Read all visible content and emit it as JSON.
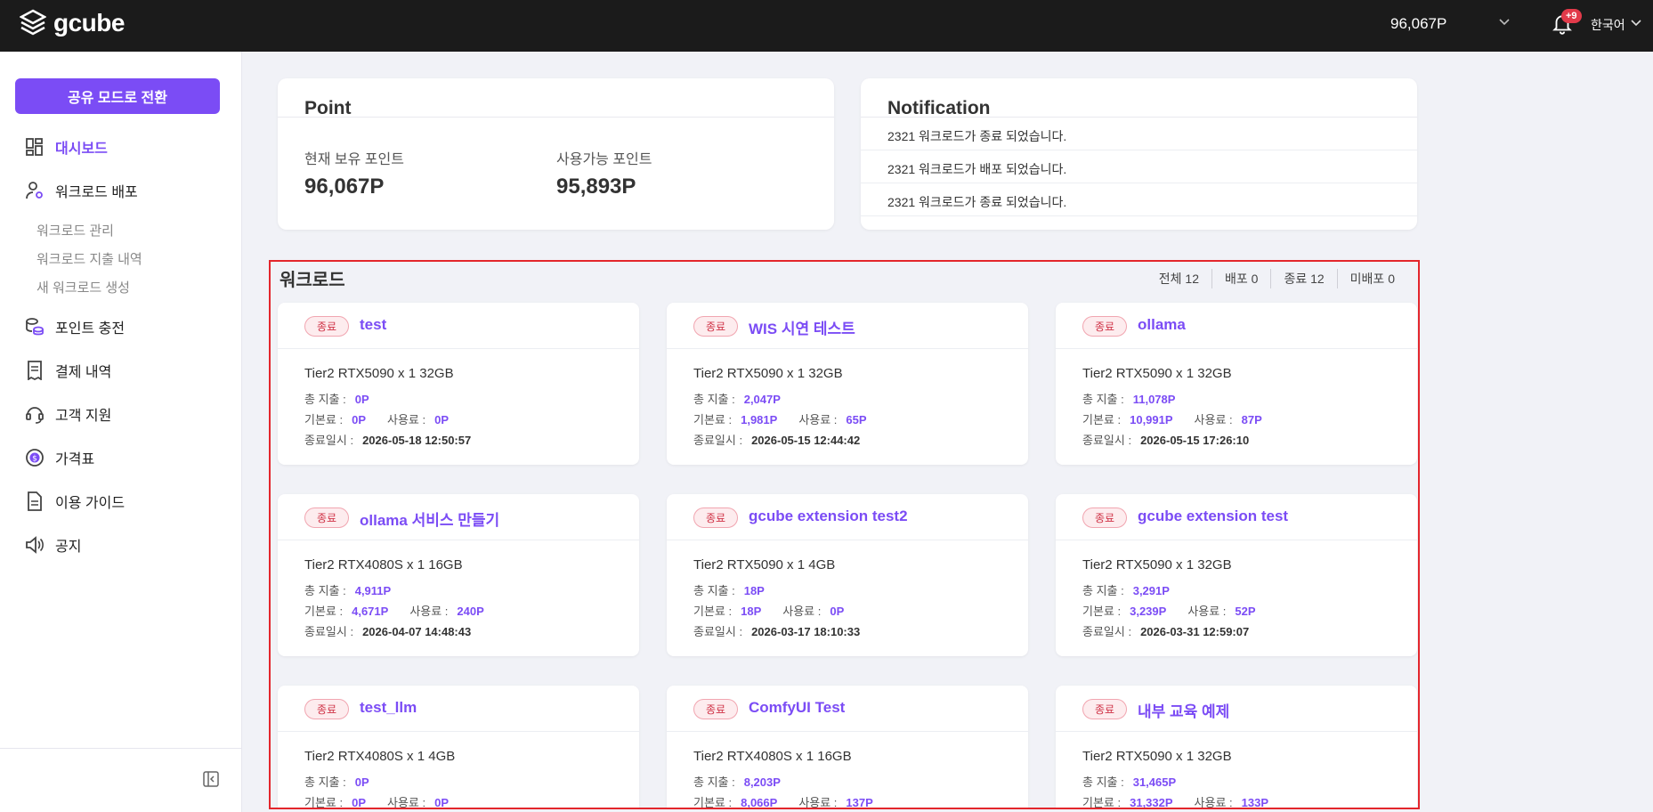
{
  "header": {
    "logo": "gcube",
    "points": "96,067P",
    "notification_badge": "+9",
    "language": "한국어"
  },
  "sidebar": {
    "share_mode_button": "공유 모드로 전환",
    "items": [
      {
        "label": "대시보드",
        "icon": "dashboard-icon",
        "active": true
      },
      {
        "label": "워크로드 배포",
        "icon": "user-gear-icon"
      },
      {
        "label": "포인트 충전",
        "icon": "coins-icon"
      },
      {
        "label": "결제 내역",
        "icon": "receipt-icon"
      },
      {
        "label": "고객 지원",
        "icon": "headset-icon"
      },
      {
        "label": "가격표",
        "icon": "dollar-circle-icon"
      },
      {
        "label": "이용 가이드",
        "icon": "document-icon"
      },
      {
        "label": "공지",
        "icon": "megaphone-icon"
      }
    ],
    "subitems": [
      "워크로드 관리",
      "워크로드 지출 내역",
      "새 워크로드 생성"
    ]
  },
  "point_panel": {
    "title": "Point",
    "held_label": "현재 보유 포인트",
    "held_value": "96,067P",
    "available_label": "사용가능 포인트",
    "available_value": "95,893P"
  },
  "notification_panel": {
    "title": "Notification",
    "items": [
      "2321 워크로드가 종료 되었습니다.",
      "2321 워크로드가 배포 되었습니다.",
      "2321 워크로드가 종료 되었습니다."
    ]
  },
  "workloads": {
    "title": "워크로드",
    "filters": [
      "전체 12",
      "배포 0",
      "종료 12",
      "미배포 0"
    ],
    "labels": {
      "total": "총 지출 :",
      "base": "기본료 :",
      "usage": "사용료 :",
      "ended": "종료일시 :"
    },
    "cards": [
      {
        "status": "종료",
        "name": "test",
        "spec": "Tier2 RTX5090 x 1 32GB",
        "total": "0P",
        "base": "0P",
        "usage": "0P",
        "ended": "2026-05-18 12:50:57"
      },
      {
        "status": "종료",
        "name": "WIS 시연 테스트",
        "spec": "Tier2 RTX5090 x 1 32GB",
        "total": "2,047P",
        "base": "1,981P",
        "usage": "65P",
        "ended": "2026-05-15 12:44:42"
      },
      {
        "status": "종료",
        "name": "ollama",
        "spec": "Tier2 RTX5090 x 1 32GB",
        "total": "11,078P",
        "base": "10,991P",
        "usage": "87P",
        "ended": "2026-05-15 17:26:10"
      },
      {
        "status": "종료",
        "name": "ollama 서비스 만들기",
        "spec": "Tier2 RTX4080S x 1 16GB",
        "total": "4,911P",
        "base": "4,671P",
        "usage": "240P",
        "ended": "2026-04-07 14:48:43"
      },
      {
        "status": "종료",
        "name": "gcube extension test2",
        "spec": "Tier2 RTX5090 x 1 4GB",
        "total": "18P",
        "base": "18P",
        "usage": "0P",
        "ended": "2026-03-17 18:10:33"
      },
      {
        "status": "종료",
        "name": "gcube extension test",
        "spec": "Tier2 RTX5090 x 1 32GB",
        "total": "3,291P",
        "base": "3,239P",
        "usage": "52P",
        "ended": "2026-03-31 12:59:07"
      },
      {
        "status": "종료",
        "name": "test_llm",
        "spec": "Tier2 RTX4080S x 1 4GB",
        "total": "0P",
        "base": "0P",
        "usage": "0P",
        "ended": ""
      },
      {
        "status": "종료",
        "name": "ComfyUI Test",
        "spec": "Tier2 RTX4080S x 1 16GB",
        "total": "8,203P",
        "base": "8,066P",
        "usage": "137P",
        "ended": ""
      },
      {
        "status": "종료",
        "name": "내부 교육 예제",
        "spec": "Tier2 RTX5090 x 1 32GB",
        "total": "31,465P",
        "base": "31,332P",
        "usage": "133P",
        "ended": ""
      }
    ]
  },
  "colors": {
    "accent": "#7b4cf5",
    "topbar": "#1b1b1b",
    "status": "#d03448",
    "highlight_frame": "#e3262c"
  }
}
